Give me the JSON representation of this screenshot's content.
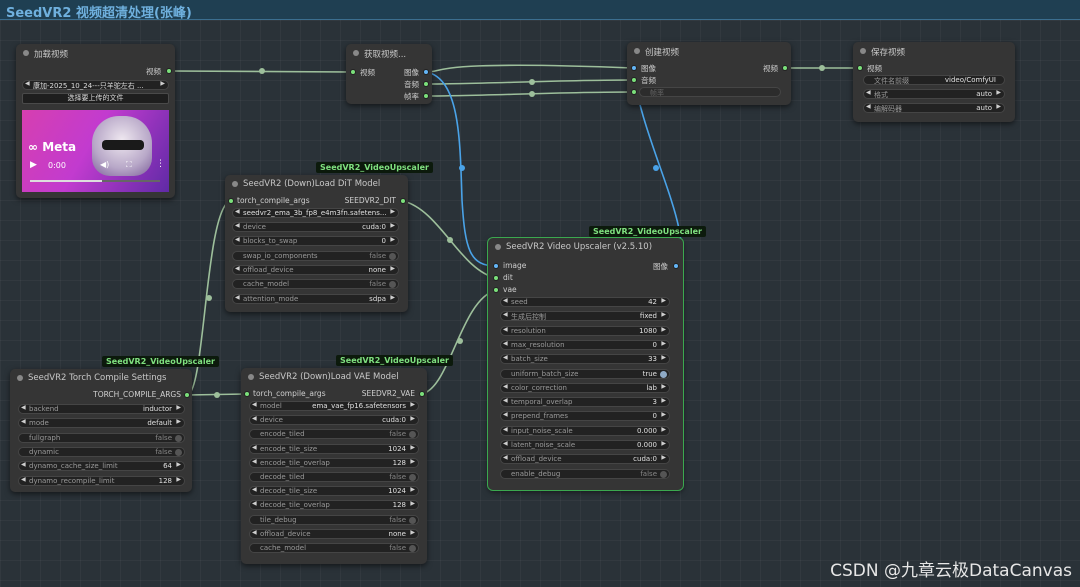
{
  "app": {
    "title": "SeedVR2 视频超清处理(张峰)"
  },
  "watermark": "CSDN @九章云极DataCanvas",
  "nodes": {
    "load_video": {
      "title": "加载视频",
      "out": "视频",
      "file": "康加-2025_10_24---只羊驼左右 ...",
      "upload_btn": "选择要上传的文件",
      "video_brand": "Meta",
      "video_time": "0:00",
      "play_icon": "play-icon"
    },
    "get_video": {
      "title": "获取视频...",
      "in": "视频",
      "out": [
        "图像",
        "音频",
        "帧率"
      ]
    },
    "create_video": {
      "title": "创建视频",
      "in": [
        "图像",
        "音频",
        "帧率"
      ],
      "out": "视频"
    },
    "save_video": {
      "title": "保存视频",
      "in": "视频",
      "widgets": [
        {
          "label": "文件名前缀",
          "value": "video/ComfyUI"
        },
        {
          "label": "格式",
          "value": "auto"
        },
        {
          "label": "编解码器",
          "value": "auto"
        }
      ]
    },
    "dit": {
      "badge": "SeedVR2_VideoUpscaler",
      "title": "SeedVR2 (Down)Load DiT Model",
      "in": "torch_compile_args",
      "out": "SEEDVR2_DIT",
      "model": "seedvr2_ema_3b_fp8_e4m3fn.safetens...",
      "widgets": [
        {
          "label": "device",
          "value": "cuda:0"
        },
        {
          "label": "blocks_to_swap",
          "value": "0"
        },
        {
          "label": "swap_io_components",
          "value": "false"
        },
        {
          "label": "offload_device",
          "value": "none"
        },
        {
          "label": "cache_model",
          "value": "false"
        },
        {
          "label": "attention_mode",
          "value": "sdpa"
        }
      ]
    },
    "torch": {
      "badge": "SeedVR2_VideoUpscaler",
      "title": "SeedVR2 Torch Compile Settings",
      "out": "TORCH_COMPILE_ARGS",
      "widgets": [
        {
          "label": "backend",
          "value": "inductor"
        },
        {
          "label": "mode",
          "value": "default"
        },
        {
          "label": "fullgraph",
          "value": "false"
        },
        {
          "label": "dynamic",
          "value": "false"
        },
        {
          "label": "dynamo_cache_size_limit",
          "value": "64"
        },
        {
          "label": "dynamo_recompile_limit",
          "value": "128"
        }
      ]
    },
    "vae": {
      "badge": "SeedVR2_VideoUpscaler",
      "title": "SeedVR2 (Down)Load VAE Model",
      "in": "torch_compile_args",
      "out": "SEEDVR2_VAE",
      "widgets": [
        {
          "label": "model",
          "value": "ema_vae_fp16.safetensors"
        },
        {
          "label": "device",
          "value": "cuda:0"
        },
        {
          "label": "encode_tiled",
          "value": "false"
        },
        {
          "label": "encode_tile_size",
          "value": "1024"
        },
        {
          "label": "encode_tile_overlap",
          "value": "128"
        },
        {
          "label": "decode_tiled",
          "value": "false"
        },
        {
          "label": "decode_tile_size",
          "value": "1024"
        },
        {
          "label": "decode_tile_overlap",
          "value": "128"
        },
        {
          "label": "tile_debug",
          "value": "false"
        },
        {
          "label": "offload_device",
          "value": "none"
        },
        {
          "label": "cache_model",
          "value": "false"
        }
      ]
    },
    "upscaler": {
      "badge": "SeedVR2_VideoUpscaler",
      "title": "SeedVR2 Video Upscaler (v2.5.10)",
      "in": [
        "image",
        "dit",
        "vae"
      ],
      "out": "图像",
      "widgets": [
        {
          "label": "seed",
          "value": "42"
        },
        {
          "label": "生成后控制",
          "value": "fixed"
        },
        {
          "label": "resolution",
          "value": "1080"
        },
        {
          "label": "max_resolution",
          "value": "0"
        },
        {
          "label": "batch_size",
          "value": "33"
        },
        {
          "label": "uniform_batch_size",
          "value": "true"
        },
        {
          "label": "color_correction",
          "value": "lab"
        },
        {
          "label": "temporal_overlap",
          "value": "3"
        },
        {
          "label": "prepend_frames",
          "value": "0"
        },
        {
          "label": "input_noise_scale",
          "value": "0.000"
        },
        {
          "label": "latent_noise_scale",
          "value": "0.000"
        },
        {
          "label": "offload_device",
          "value": "cuda:0"
        },
        {
          "label": "enable_debug",
          "value": "false"
        }
      ]
    }
  },
  "colors": {
    "link_green": "#9dbf9b",
    "link_blue": "#4aa3e8",
    "image_slot": "#64b5f6",
    "green_slot": "#7be07b",
    "selection": "#3ba84f"
  }
}
